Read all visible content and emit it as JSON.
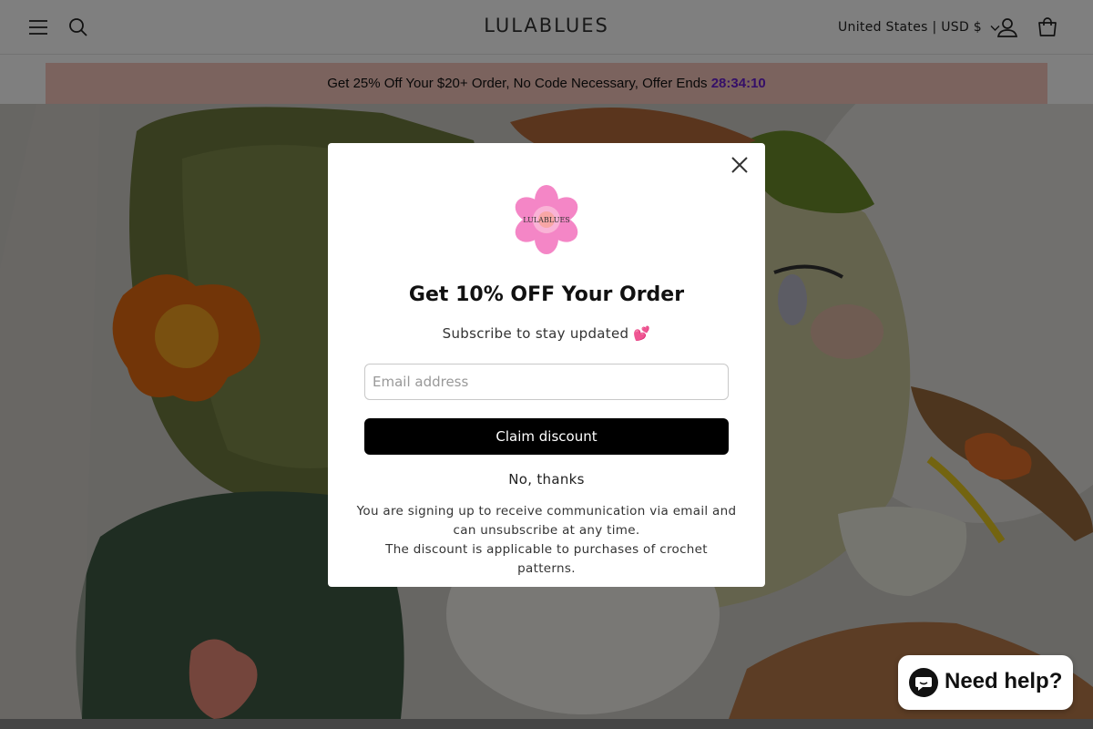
{
  "header": {
    "brand": "LULABLUES",
    "country_selector": "United States | USD $"
  },
  "announcement": {
    "text": "Get 25% Off Your $20+ Order, No Code Necessary, Offer Ends ",
    "timer": "28:34:10"
  },
  "popup": {
    "logo_text": "LULABLUES",
    "title": "Get 10% OFF Your Order",
    "subtitle": "Subscribe to stay updated 💕",
    "email_placeholder": "Email address",
    "email_value": "",
    "claim_label": "Claim discount",
    "dismiss_label": "No, thanks",
    "disclaimer_line1": "You are signing up to receive communication via email and can unsubscribe at any time.",
    "disclaimer_line2": "The discount is applicable to purchases of crochet patterns."
  },
  "chat": {
    "label": "Need help?"
  },
  "colors": {
    "announcement_bg": "#f7c6bc",
    "timer": "#6a1fd0",
    "button": "#000000"
  },
  "icons": [
    "menu-icon",
    "search-icon",
    "chevron-down-icon",
    "account-icon",
    "cart-icon",
    "close-icon",
    "chat-bubble-icon"
  ]
}
